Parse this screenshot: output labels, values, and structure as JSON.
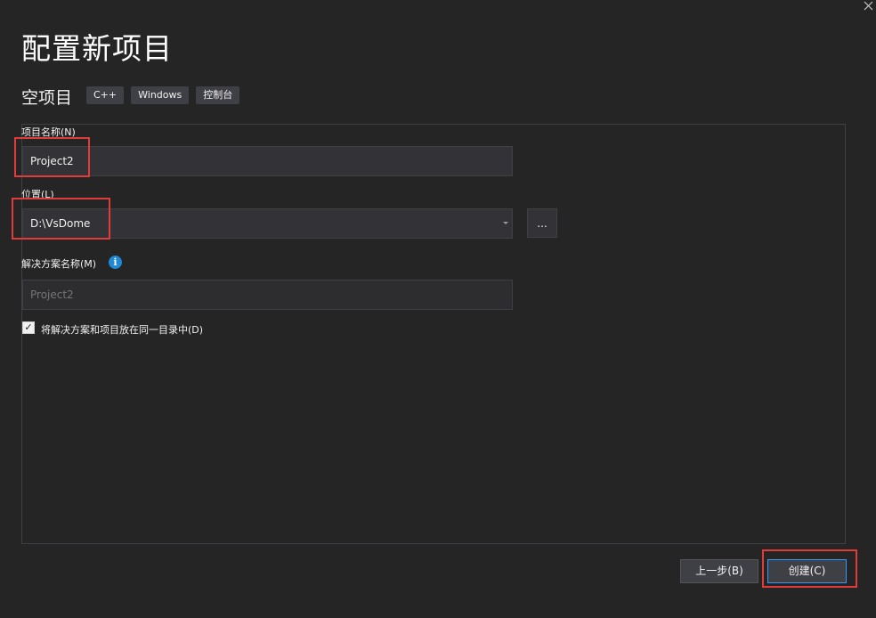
{
  "window": {
    "close_label": "✕"
  },
  "header": {
    "title": "配置新项目",
    "template_name": "空项目",
    "tags": [
      "C++",
      "Windows",
      "控制台"
    ]
  },
  "form": {
    "project_name": {
      "label": "项目名称(N)",
      "value": "Project2"
    },
    "location": {
      "label": "位置(L)",
      "value": "D:\\VsDome",
      "browse_label": "..."
    },
    "solution_name": {
      "label": "解决方案名称(M)",
      "placeholder": "Project2",
      "info_icon": "i"
    },
    "same_dir": {
      "label": "将解决方案和项目放在同一目录中(D)",
      "checked": true,
      "check_mark": "✓"
    }
  },
  "footer": {
    "back_label": "上一步(B)",
    "create_label": "创建(C)"
  },
  "colors": {
    "background": "#252526",
    "field": "#333337",
    "border": "#3f3f46",
    "accent": "#3399ff",
    "highlight": "#e03c3c",
    "info": "#1e8ad6"
  }
}
